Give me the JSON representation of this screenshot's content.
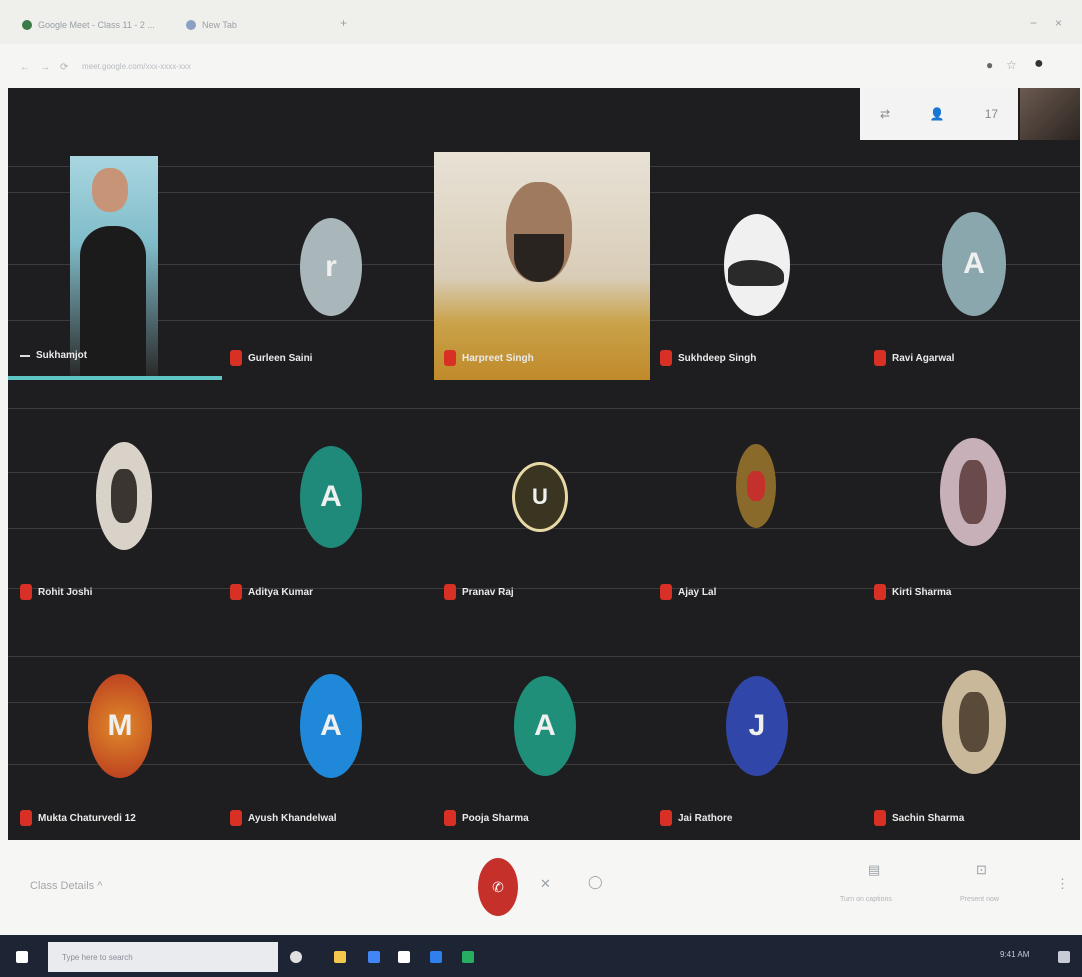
{
  "browser": {
    "tabs": [
      {
        "label": "Google Meet - Class 11 - 2 ..."
      },
      {
        "label": "New Tab"
      }
    ],
    "url": "meet.google.com/xxx-xxxx-xxx"
  },
  "overlay": {
    "people_count": "17"
  },
  "participants": [
    {
      "name": "Sukhamjot",
      "avatar_letter": "",
      "type": "video",
      "color": "#7fbcc9"
    },
    {
      "name": "Gurleen Saini",
      "avatar_letter": "r",
      "type": "avatar",
      "color": "#a9b7ba"
    },
    {
      "name": "Harpreet Singh",
      "avatar_letter": "",
      "type": "video",
      "color": "#c9a24a"
    },
    {
      "name": "Sukhdeep Singh",
      "avatar_letter": "",
      "type": "photo",
      "color": "#dadada"
    },
    {
      "name": "Ravi Agarwal",
      "avatar_letter": "A",
      "type": "avatar",
      "color": "#8aa7ad"
    },
    {
      "name": "Rohit Joshi",
      "avatar_letter": "",
      "type": "photo",
      "color": "#d8d2c8"
    },
    {
      "name": "Aditya Kumar",
      "avatar_letter": "A",
      "type": "avatar",
      "color": "#1f8a7a"
    },
    {
      "name": "Pranav Raj",
      "avatar_letter": "U",
      "type": "photo",
      "color": "#3a3520"
    },
    {
      "name": "Ajay Lal",
      "avatar_letter": "",
      "type": "photo",
      "color": "#8a6a2a"
    },
    {
      "name": "Kirti Sharma",
      "avatar_letter": "",
      "type": "photo",
      "color": "#c7b0b8"
    },
    {
      "name": "Mukta Chaturvedi 12",
      "avatar_letter": "M",
      "type": "avatar",
      "color": "#d0661f"
    },
    {
      "name": "Ayush Khandelwal",
      "avatar_letter": "A",
      "type": "avatar",
      "color": "#1f88d8"
    },
    {
      "name": "Pooja Sharma",
      "avatar_letter": "A",
      "type": "avatar",
      "color": "#1f8f7a"
    },
    {
      "name": "Jai Rathore",
      "avatar_letter": "J",
      "type": "avatar",
      "color": "#3046a8"
    },
    {
      "name": "Sachin Sharma",
      "avatar_letter": "",
      "type": "photo",
      "color": "#c9b89a"
    }
  ],
  "bottom": {
    "meeting_name": "Class Details ^",
    "present_label": "Present now",
    "captions_label": "Turn on captions"
  },
  "taskbar": {
    "search_placeholder": "Type here to search",
    "time": "9:41 AM"
  },
  "colors": {
    "stage_bg": "#1e1e20",
    "mic_off": "#d93025",
    "end_call": "#c5302b",
    "active_speaker": "#5ec5c5"
  }
}
